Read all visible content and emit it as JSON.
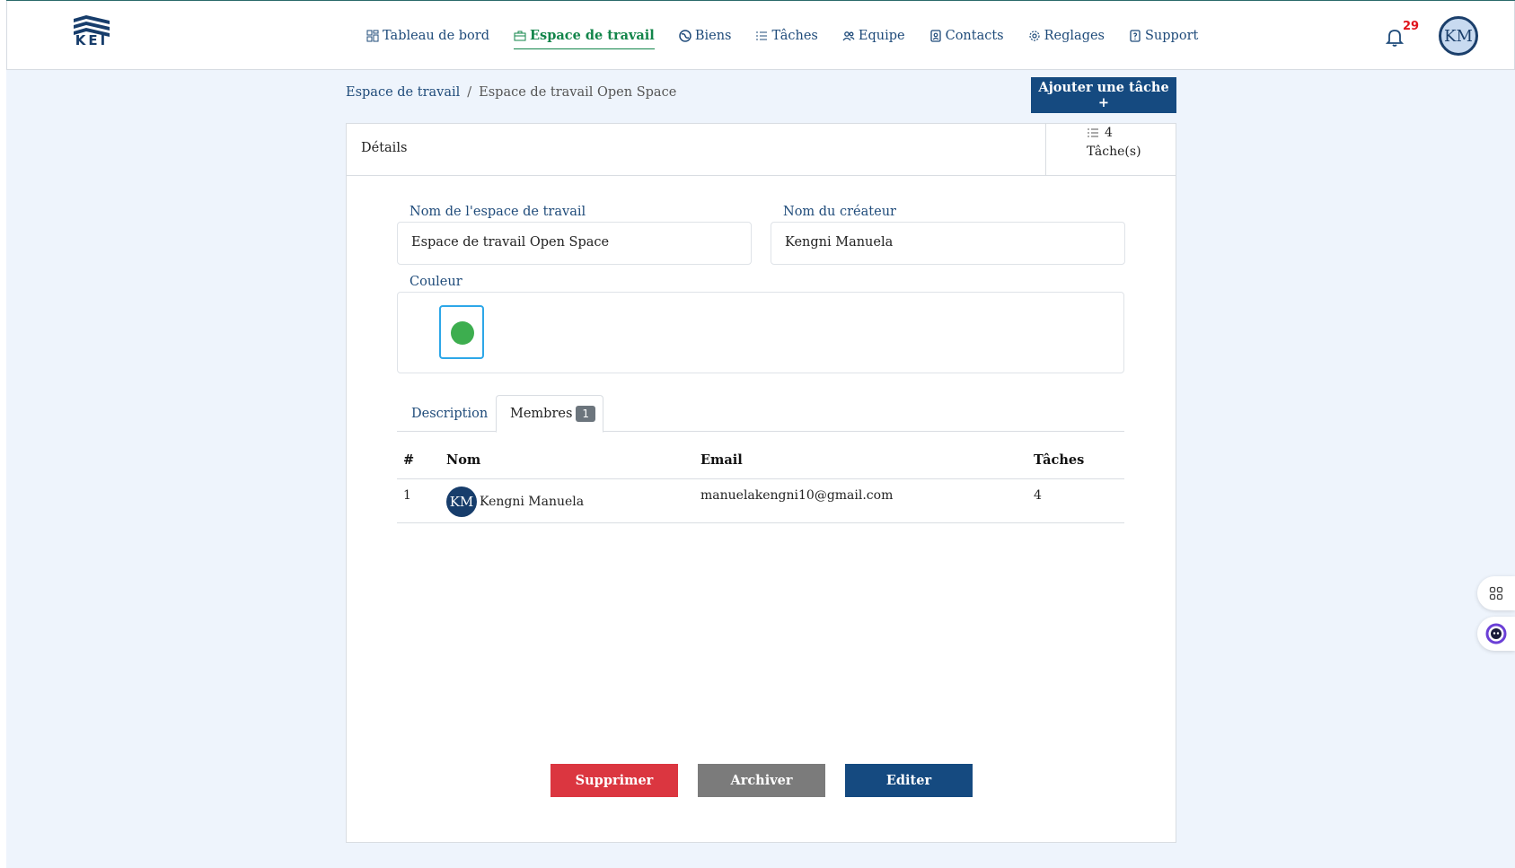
{
  "brand": {
    "logo_text": "KEI"
  },
  "nav": {
    "items": [
      {
        "label": "Tableau de bord",
        "icon": "dashboard-icon"
      },
      {
        "label": "Espace de travail",
        "icon": "briefcase-icon",
        "active": true
      },
      {
        "label": "Biens",
        "icon": "globe-icon"
      },
      {
        "label": "Tâches",
        "icon": "list-icon"
      },
      {
        "label": "Equipe",
        "icon": "team-icon"
      },
      {
        "label": "Contacts",
        "icon": "contacts-icon"
      },
      {
        "label": "Reglages",
        "icon": "gear-icon"
      },
      {
        "label": "Support",
        "icon": "help-icon"
      }
    ],
    "notifications_count": "29",
    "user_initials": "KM"
  },
  "breadcrumb": {
    "parent": "Espace de travail",
    "separator": "/",
    "current": "Espace de travail Open Space"
  },
  "actions": {
    "add_task": "Ajouter une tâche +"
  },
  "card": {
    "title": "Détails",
    "task_count": "4",
    "task_count_label": "Tâche(s)"
  },
  "form": {
    "workspace_name_label": "Nom de l'espace de travail",
    "workspace_name_value": "Espace de travail Open Space",
    "creator_label": "Nom du créateur",
    "creator_value": "Kengni Manuela",
    "color_label": "Couleur",
    "color_value": "#3dae4f"
  },
  "tabs": {
    "description": "Description",
    "members": "Membres",
    "members_count": "1"
  },
  "table": {
    "headers": [
      "#",
      "Nom",
      "Email",
      "Tâches"
    ],
    "rows": [
      {
        "index": "1",
        "initials": "KM",
        "name": "Kengni Manuela",
        "email": "manuelakengni10@gmail.com",
        "tasks": "4"
      }
    ]
  },
  "buttons": {
    "delete": "Supprimer",
    "archive": "Archiver",
    "edit": "Editer"
  },
  "colors": {
    "primary": "#154a80",
    "active_nav": "#12854a",
    "danger": "#db3640",
    "secondary": "#7b7b7b",
    "notification": "#e0151d"
  }
}
